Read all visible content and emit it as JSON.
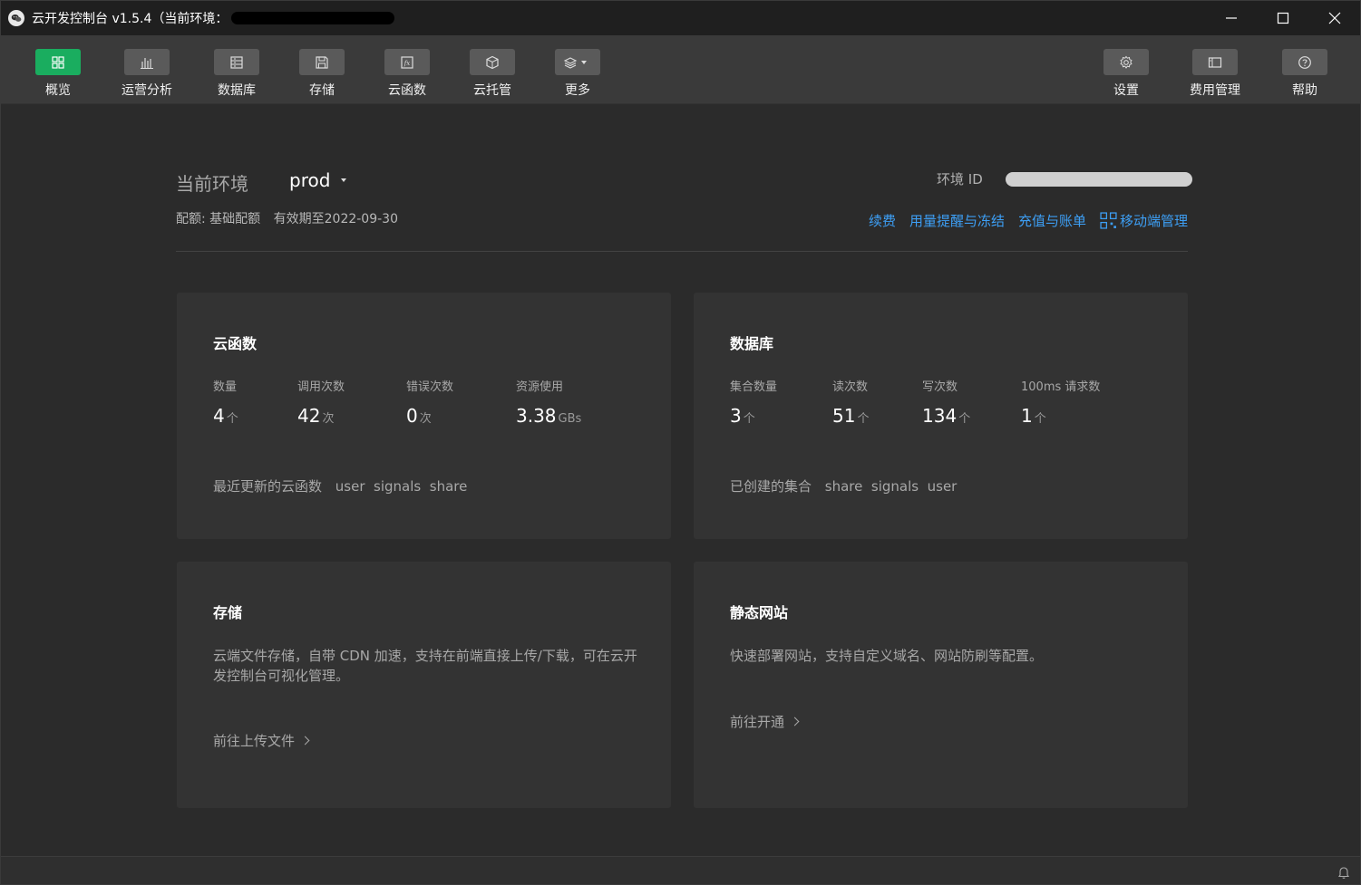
{
  "window": {
    "title": "云开发控制台 v1.5.4（当前环境："
  },
  "toolbar": {
    "items": [
      {
        "label": "概览",
        "icon": "grid-icon"
      },
      {
        "label": "运营分析",
        "icon": "bar-chart-icon"
      },
      {
        "label": "数据库",
        "icon": "database-icon"
      },
      {
        "label": "存储",
        "icon": "save-icon"
      },
      {
        "label": "云函数",
        "icon": "function-icon"
      },
      {
        "label": "云托管",
        "icon": "cube-icon"
      },
      {
        "label": "更多",
        "icon": "layers-icon"
      }
    ],
    "right_items": [
      {
        "label": "设置",
        "icon": "gear-icon"
      },
      {
        "label": "费用管理",
        "icon": "billing-icon"
      },
      {
        "label": "帮助",
        "icon": "help-icon"
      }
    ],
    "active_color": "#1aad5f"
  },
  "env": {
    "label": "当前环境",
    "value": "prod",
    "quota_label": "配额: 基础配额",
    "expiry": "有效期至2022-09-30",
    "id_label": "环境 ID"
  },
  "links": {
    "renew": "续费",
    "usage_alert": "用量提醒与冻结",
    "recharge": "充值与账单",
    "mobile": "移动端管理",
    "color": "#3d9ff5"
  },
  "functions_card": {
    "title": "云函数",
    "stats": [
      {
        "label": "数量",
        "value": "4",
        "unit": "个"
      },
      {
        "label": "调用次数",
        "value": "42",
        "unit": "次"
      },
      {
        "label": "错误次数",
        "value": "0",
        "unit": "次"
      },
      {
        "label": "资源使用",
        "value": "3.38",
        "unit": "GBs"
      }
    ],
    "foot_label": "最近更新的云函数",
    "foot_names": "user  signals  share"
  },
  "database_card": {
    "title": "数据库",
    "stats": [
      {
        "label": "集合数量",
        "value": "3",
        "unit": "个"
      },
      {
        "label": "读次数",
        "value": "51",
        "unit": "个"
      },
      {
        "label": "写次数",
        "value": "134",
        "unit": "个"
      },
      {
        "label": "100ms 请求数",
        "value": "1",
        "unit": "个"
      }
    ],
    "foot_label": "已创建的集合",
    "foot_names": "share  signals  user"
  },
  "storage_card": {
    "title": "存储",
    "desc": "云端文件存储，自带 CDN 加速，支持在前端直接上传/下载，可在云开发控制台可视化管理。",
    "link": "前往上传文件"
  },
  "static_card": {
    "title": "静态网站",
    "desc": "快速部署网站，支持自定义域名、网站防刷等配置。",
    "link": "前往开通"
  }
}
